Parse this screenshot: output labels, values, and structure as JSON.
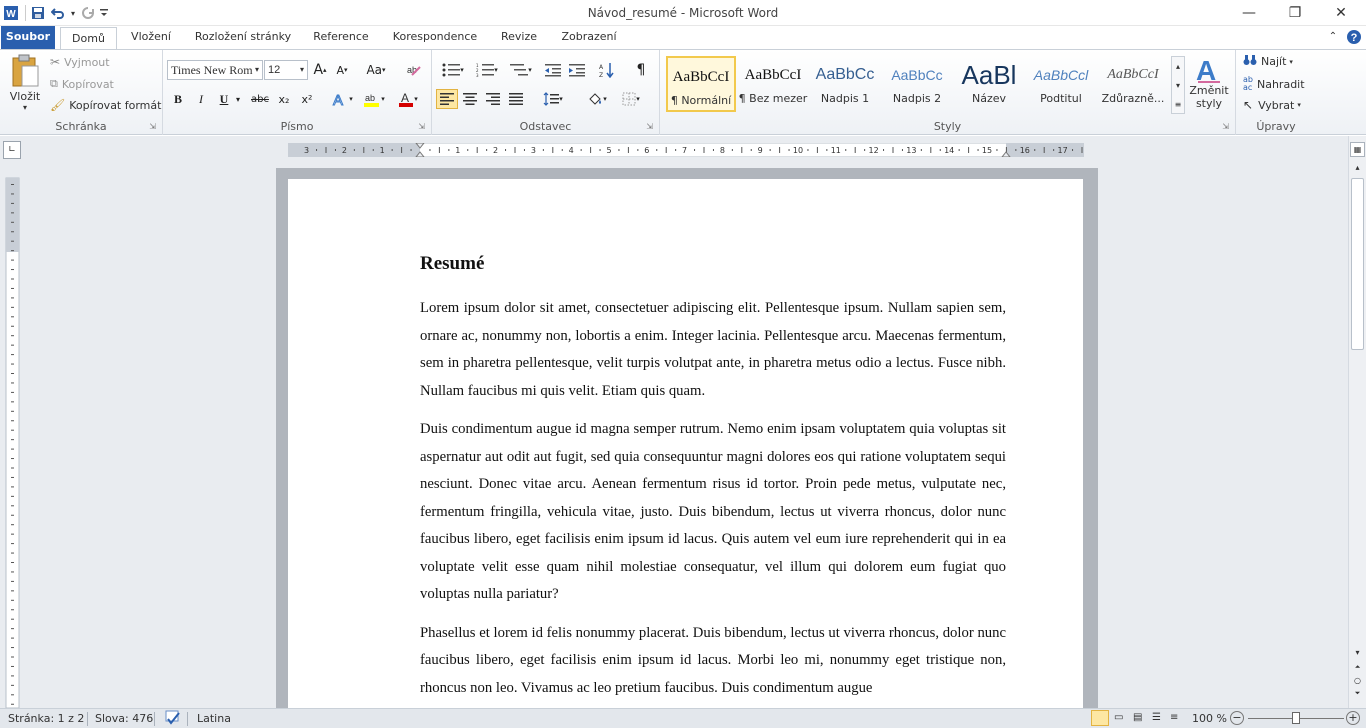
{
  "window": {
    "title": "Návod_resumé  -  Microsoft Word",
    "controls": {
      "minimize": "—",
      "restore": "❐",
      "close": "✕"
    }
  },
  "tabs": {
    "file": "Soubor",
    "items": [
      "Domů",
      "Vložení",
      "Rozložení stránky",
      "Reference",
      "Korespondence",
      "Revize",
      "Zobrazení"
    ],
    "active": "Domů"
  },
  "ribbon": {
    "clipboard": {
      "label": "Schránka",
      "paste": "Vložit",
      "cut": "Vyjmout",
      "copy": "Kopírovat",
      "format_painter": "Kopírovat formát"
    },
    "font": {
      "label": "Písmo",
      "font_name": "Times New Rom",
      "font_size": "12",
      "grow": "A",
      "shrink": "A",
      "change_case": "Aa",
      "bold": "B",
      "italic": "I",
      "underline": "U",
      "strike": "abc",
      "subscript": "x₂",
      "superscript": "x²",
      "font_color_letter": "A"
    },
    "paragraph": {
      "label": "Odstavec",
      "pilcrow": "¶"
    },
    "styles": {
      "label": "Styly",
      "tiles": [
        {
          "sample": "AaBbCcI",
          "name": "¶ Normální"
        },
        {
          "sample": "AaBbCcI",
          "name": "¶ Bez mezer"
        },
        {
          "sample": "AaBbCc",
          "name": "Nadpis 1"
        },
        {
          "sample": "AaBbCc",
          "name": "Nadpis 2"
        },
        {
          "sample": "AaBl",
          "name": "Název"
        },
        {
          "sample": "AaBbCcl",
          "name": "Podtitul"
        },
        {
          "sample": "AaBbCcI",
          "name": "Zdůrazně..."
        }
      ],
      "change_styles_line1": "Změnit",
      "change_styles_line2": "styly"
    },
    "editing": {
      "label": "Úpravy",
      "find": "Najít",
      "replace": "Nahradit",
      "select": "Vybrat"
    }
  },
  "document": {
    "heading": "Resumé",
    "paragraphs": [
      "Lorem ipsum dolor sit amet, consectetuer adipiscing elit. Pellentesque ipsum. Nullam sapien sem, ornare ac, nonummy non, lobortis a enim. Integer lacinia. Pellentesque arcu. Maecenas fermentum, sem in pharetra pellentesque, velit turpis volutpat ante, in pharetra metus odio a lectus. Fusce nibh. Nullam faucibus mi quis velit. Etiam quis quam.",
      "Duis condimentum augue id magna semper rutrum. Nemo enim ipsam voluptatem quia voluptas sit aspernatur aut odit aut fugit, sed quia consequuntur magni dolores eos qui ratione voluptatem sequi nesciunt. Donec vitae arcu. Aenean fermentum risus id tortor. Proin pede metus, vulputate nec, fermentum fringilla, vehicula vitae, justo. Duis bibendum, lectus ut viverra rhoncus, dolor nunc faucibus libero, eget facilisis enim ipsum id lacus. Quis autem vel eum iure reprehenderit qui in ea voluptate velit esse quam nihil molestiae consequatur, vel illum qui dolorem eum fugiat quo voluptas nulla pariatur?",
      "Phasellus et lorem id felis nonummy placerat. Duis bibendum, lectus ut viverra rhoncus, dolor nunc faucibus libero, eget facilisis enim ipsum id lacus. Morbi leo mi, nonummy eget tristique non, rhoncus non leo. Vivamus ac leo pretium faucibus. Duis condimentum augue"
    ]
  },
  "ruler": {
    "labels": [
      "3",
      "2",
      "1",
      "1",
      "2",
      "3",
      "4",
      "5",
      "6",
      "7",
      "8",
      "9",
      "10",
      "11",
      "12",
      "13",
      "14",
      "15",
      "16",
      "17"
    ]
  },
  "statusbar": {
    "page": "Stránka: 1 z 2",
    "words": "Slova: 476",
    "language": "Latina",
    "zoom": "100 %"
  },
  "colors": {
    "file_tab": "#2a5fae",
    "ribbon_bg": "#eef1f5",
    "canvas_bg": "#e9ecf0",
    "highlight_yellow": "#ffff00",
    "font_red": "#d40000"
  }
}
